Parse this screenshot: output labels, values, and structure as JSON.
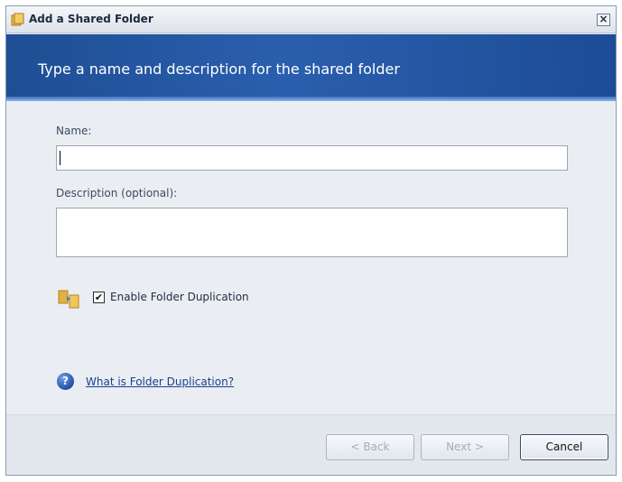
{
  "window": {
    "title": "Add a Shared Folder",
    "close_label": "×"
  },
  "banner": {
    "title": "Type a name and description for the shared folder"
  },
  "form": {
    "name_label": "Name:",
    "name_value": "",
    "description_label": "Description (optional):",
    "description_value": ""
  },
  "duplication": {
    "checkbox_label": "Enable Folder Duplication",
    "checked": true,
    "check_mark": "✔",
    "icon": "folder-duplication-icon"
  },
  "help": {
    "icon": "help-icon",
    "icon_glyph": "?",
    "link_label": "What is Folder Duplication?"
  },
  "buttons": {
    "back_label": "< Back",
    "next_label": "Next >",
    "cancel_label": "Cancel"
  },
  "colors": {
    "banner": "#2a5fae",
    "link": "#1b3f8f",
    "dialog_bg": "#e8edf3"
  }
}
